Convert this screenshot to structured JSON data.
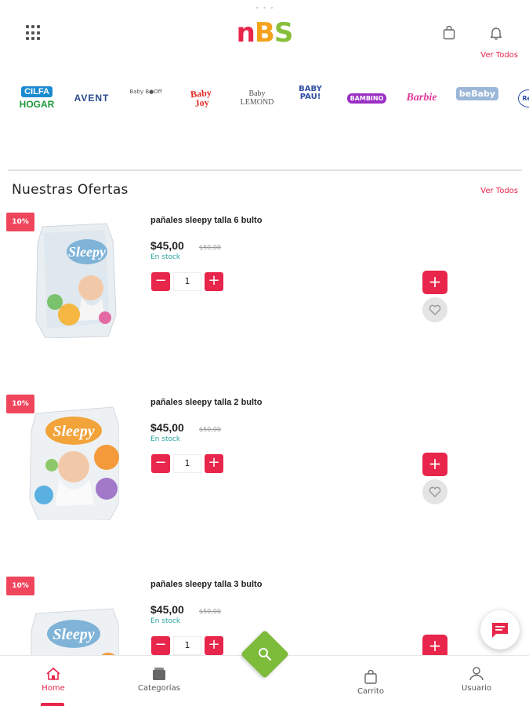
{
  "header": {
    "logo": {
      "part1": "n",
      "part2": "B",
      "part3": "S"
    },
    "see_all_label": "Ver Todos"
  },
  "brands": {
    "cilfa": {
      "line1": "CILFA",
      "line2": "HOGAR"
    },
    "avent": "AVENT",
    "baby_b": "Baby B●Off",
    "baby_joy": {
      "line1": "Baby",
      "line2": "Joy"
    },
    "baby_lemond": {
      "line1": "Baby",
      "line2": "LEMOND"
    },
    "baby_paul": {
      "line1": "BABY",
      "line2": "PAU!"
    },
    "bambino": "BAMBINO",
    "barbie": "Barbie",
    "bebaby": "beBaby",
    "reb": "Reb"
  },
  "offers": {
    "title": "Nuestras Ofertas",
    "see_all_label": "Ver Todos",
    "products": [
      {
        "discount": "10%",
        "name": "pañales sleepy talla 6 bulto",
        "price": "$45,00",
        "old_price": "$50,00",
        "stock": "En stock",
        "quantity": "1",
        "image_label": "Sleepy"
      },
      {
        "discount": "10%",
        "name": "pañales sleepy talla 2 bulto",
        "price": "$45,00",
        "old_price": "$50,00",
        "stock": "En stock",
        "quantity": "1",
        "image_label": "Sleepy"
      },
      {
        "discount": "10%",
        "name": "pañales sleepy talla 3 bulto",
        "price": "$45,00",
        "old_price": "$50,00",
        "stock": "En stock",
        "quantity": "1",
        "image_label": "Sleepy"
      }
    ]
  },
  "controls": {
    "minus": "−",
    "plus": "+"
  },
  "bottom_nav": {
    "home": "Home",
    "categories": "Categorías",
    "cart": "Carrito",
    "user": "Usuario"
  },
  "colors": {
    "accent": "#e8254a",
    "green": "#7dbb3b",
    "teal": "#2aa5a0"
  }
}
